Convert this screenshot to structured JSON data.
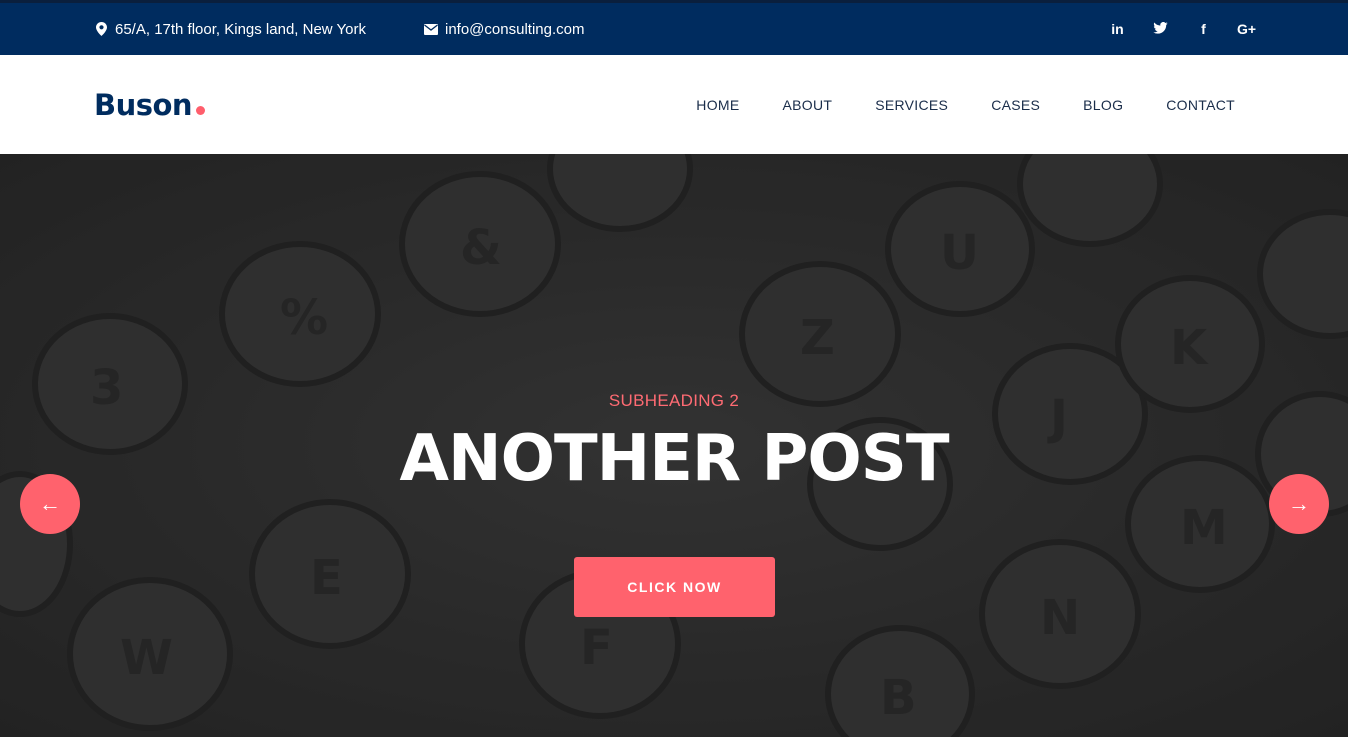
{
  "topbar": {
    "address": "65/A, 17th floor, Kings land, New York",
    "email": "info@consulting.com",
    "social": [
      {
        "icon": "linkedin-icon",
        "glyph": "in"
      },
      {
        "icon": "twitter-icon",
        "glyph": "🐦"
      },
      {
        "icon": "facebook-icon",
        "glyph": "f"
      },
      {
        "icon": "google-plus-icon",
        "glyph": "G+"
      }
    ]
  },
  "header": {
    "logo": "Buson",
    "nav": [
      "HOME",
      "ABOUT",
      "SERVICES",
      "CASES",
      "BLOG",
      "CONTACT"
    ]
  },
  "hero": {
    "subheading": "SUBHEADING 2",
    "title": "ANOTHER POST",
    "cta_label": "CLICK NOW",
    "prev_glyph": "←",
    "next_glyph": "→"
  },
  "colors": {
    "topbar_bg": "#002c5f",
    "accent": "#ff626d",
    "logo": "#002c5f"
  }
}
